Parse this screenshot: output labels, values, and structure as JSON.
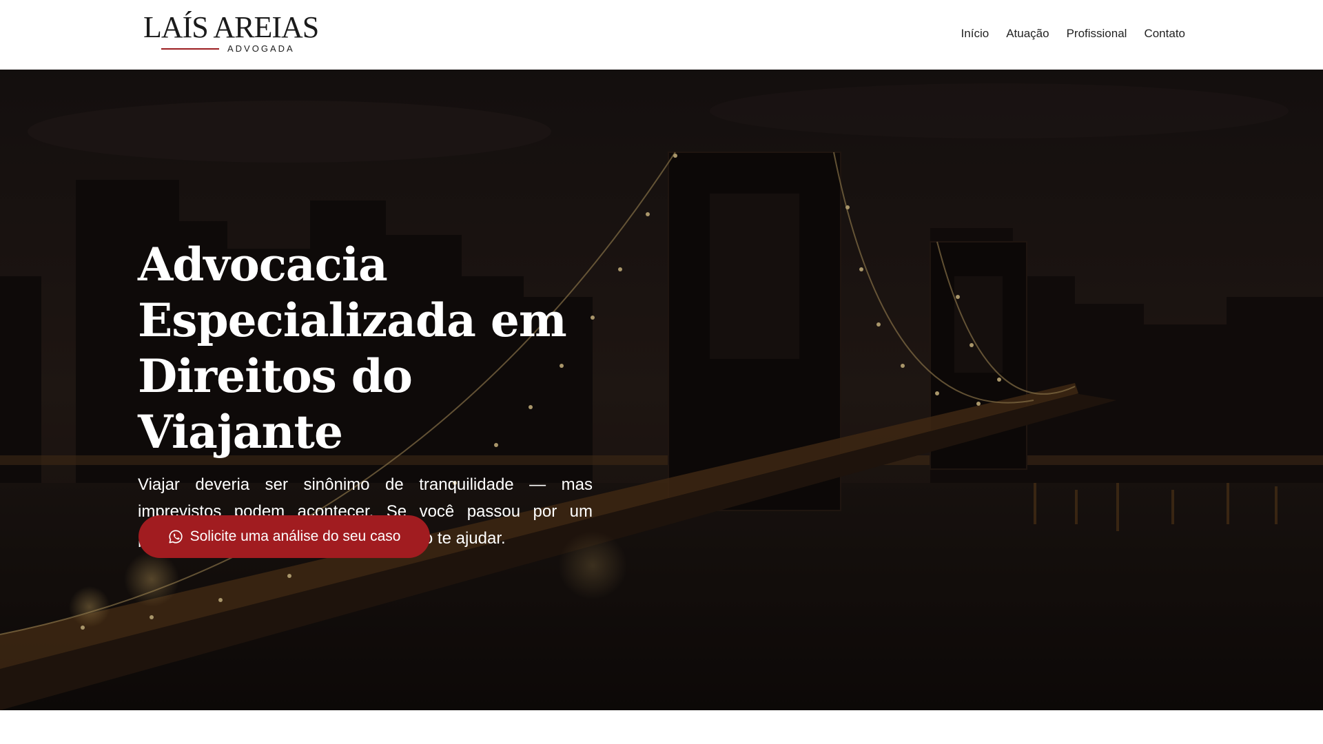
{
  "brand": {
    "name": "LAÍS AREIAS",
    "subtitle": "ADVOGADA"
  },
  "nav": {
    "items": [
      {
        "label": "Início"
      },
      {
        "label": "Atuação"
      },
      {
        "label": "Profissional"
      },
      {
        "label": "Contato"
      }
    ]
  },
  "hero": {
    "title": "Advocacia Especializada em Direitos do Viajante",
    "text": "Viajar deveria ser sinônimo de tranquilidade — mas imprevistos podem acontecer. Se você passou por um problema durante sua viagem, eu posso te ajudar.",
    "cta_label": "Solicite uma análise do seu caso",
    "cta_icon": "whatsapp-icon"
  },
  "colors": {
    "accent": "#a11c20",
    "header_bg": "#ffffff",
    "text_dark": "#222222"
  }
}
